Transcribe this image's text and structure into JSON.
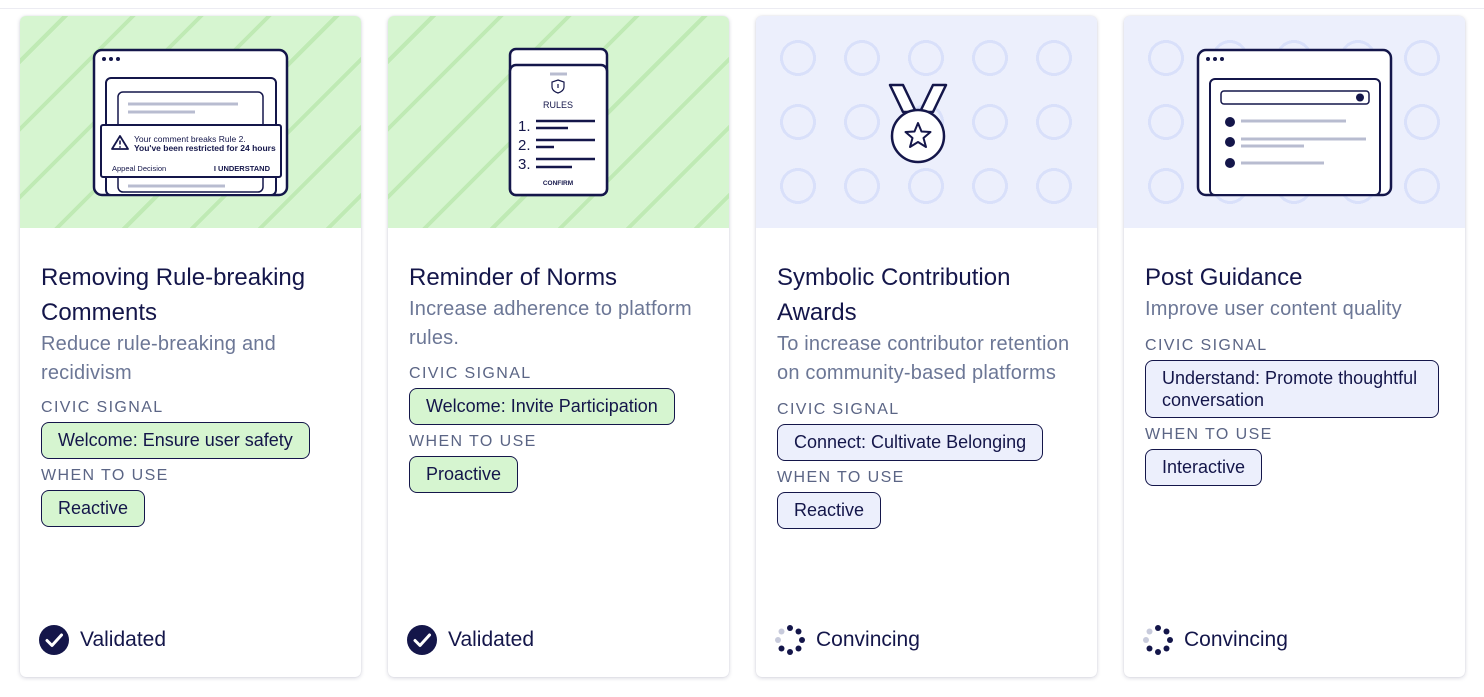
{
  "cards": [
    {
      "title": "Removing Rule-breaking Comments",
      "description": "Reduce rule-breaking and recidivism",
      "civic_signal_label": "CIVIC SIGNAL",
      "civic_signal": "Welcome: Ensure user safety",
      "when_label": "WHEN TO USE",
      "when": "Reactive",
      "status": "Validated",
      "theme": "green",
      "illustration": {
        "notice_line1": "Your comment breaks Rule 2.",
        "notice_line2": "You've been restricted for 24 hours",
        "appeal": "Appeal Decision",
        "understand": "I UNDERSTAND"
      }
    },
    {
      "title": "Reminder of Norms",
      "description": "Increase adherence to platform rules.",
      "civic_signal_label": "CIVIC SIGNAL",
      "civic_signal": "Welcome: Invite Participation",
      "when_label": "WHEN TO USE",
      "when": "Proactive",
      "status": "Validated",
      "theme": "green",
      "illustration": {
        "rules": "RULES",
        "n1": "1.",
        "n2": "2.",
        "n3": "3.",
        "confirm": "CONFIRM"
      }
    },
    {
      "title": "Symbolic Contribution Awards",
      "description": "To increase contributor retention on community-based platforms",
      "civic_signal_label": "CIVIC SIGNAL",
      "civic_signal": "Connect: Cultivate Belonging",
      "when_label": "WHEN TO USE",
      "when": "Reactive",
      "status": "Convincing",
      "theme": "blue"
    },
    {
      "title": "Post Guidance",
      "description": "Improve user content quality",
      "civic_signal_label": "CIVIC SIGNAL",
      "civic_signal": "Understand: Promote thoughtful conversation",
      "when_label": "WHEN TO USE",
      "when": "Interactive",
      "status": "Convincing",
      "theme": "blue"
    }
  ],
  "icons": {
    "validated": "check-circle-icon",
    "convincing": "dotted-spinner-icon",
    "award": "medal-icon",
    "warning": "warning-triangle-icon"
  },
  "colors": {
    "ink": "#14164a",
    "muted": "#6c7796",
    "green_bg": "#d6f5d0",
    "blue_bg": "#eceffc"
  }
}
